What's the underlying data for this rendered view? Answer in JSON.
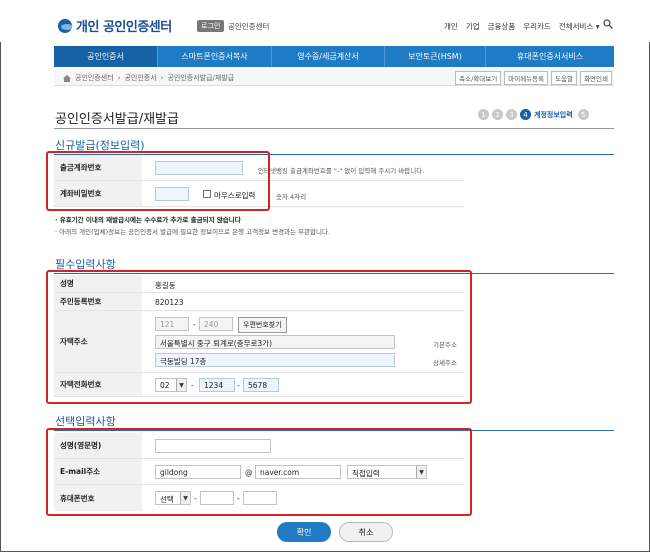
{
  "header": {
    "logo_text": "개인 공인인증센터",
    "login_btn": "로그인",
    "login_sub": "공인인증센터",
    "links": [
      "개인",
      "기업",
      "금융상품",
      "우리카드",
      "전체서비스 ▾"
    ]
  },
  "nav": {
    "items": [
      "공인인증서",
      "스마트폰인증서복사",
      "영수증/세금계산서",
      "보안토큰(HSM)",
      "휴대폰인증서서비스"
    ]
  },
  "breadcrumb": {
    "items": [
      "공인인증센터",
      "공인인증서",
      "공인인증서발급/재발급"
    ],
    "buttons": [
      "축소/확대보기",
      "마이메뉴등록",
      "도움말",
      "화면인쇄"
    ]
  },
  "page": {
    "title": "공인인증서발급/재발급",
    "steps": [
      "1",
      "2",
      "3",
      "4",
      "5"
    ],
    "current_step_label": "계정정보입력"
  },
  "section1": {
    "title": "신규발급(정보입력)",
    "row1_label": "출금계좌번호",
    "row1_hint": "인터넷뱅킹 출금계좌번호를 \"-\" 없이 입력해 주시기 바랍니다.",
    "row2_label": "계좌비밀번호",
    "row2_mouse": "마우스로입력",
    "row2_hint": "숫자 4자리",
    "note1": "· 유효기간 이내의 재발급시에는 수수료가 추가로 출금되지 않습니다",
    "note2": "· 아래의 개인(업체)정보는 공인인증서 발급에 필요한 정보이므로 은행 고객정보 변경과는 무관합니다."
  },
  "section2": {
    "title": "필수입력사항",
    "name_label": "성명",
    "name_value": "홍길동",
    "rrn_label": "주민등록번호",
    "rrn_value": "820123",
    "addr_label": "자택주소",
    "zip1": "121",
    "zip2": "240",
    "zip_btn": "우편번호찾기",
    "addr1": "서울특별시 중구 퇴계로(충무로3가)",
    "addr1_note": "기본주소",
    "addr2": "극동빌딩 17층",
    "addr2_note": "상세주소",
    "phone_label": "자택전화번호",
    "phone1": "02",
    "phone2": "1234",
    "phone3": "5678"
  },
  "section3": {
    "title": "선택입력사항",
    "eng_name_label": "성명(영문명)",
    "email_label": "E-mail주소",
    "email_id": "gildong",
    "email_at": "@",
    "email_domain": "naver.com",
    "email_select": "직접입력",
    "mobile_label": "휴대폰번호",
    "mobile_select": "선택"
  },
  "actions": {
    "ok": "확인",
    "cancel": "취소"
  },
  "colors": {
    "nav_blue": "#1f7bc4",
    "accent_blue": "#1a5ea8",
    "highlight_red": "#d32323"
  }
}
